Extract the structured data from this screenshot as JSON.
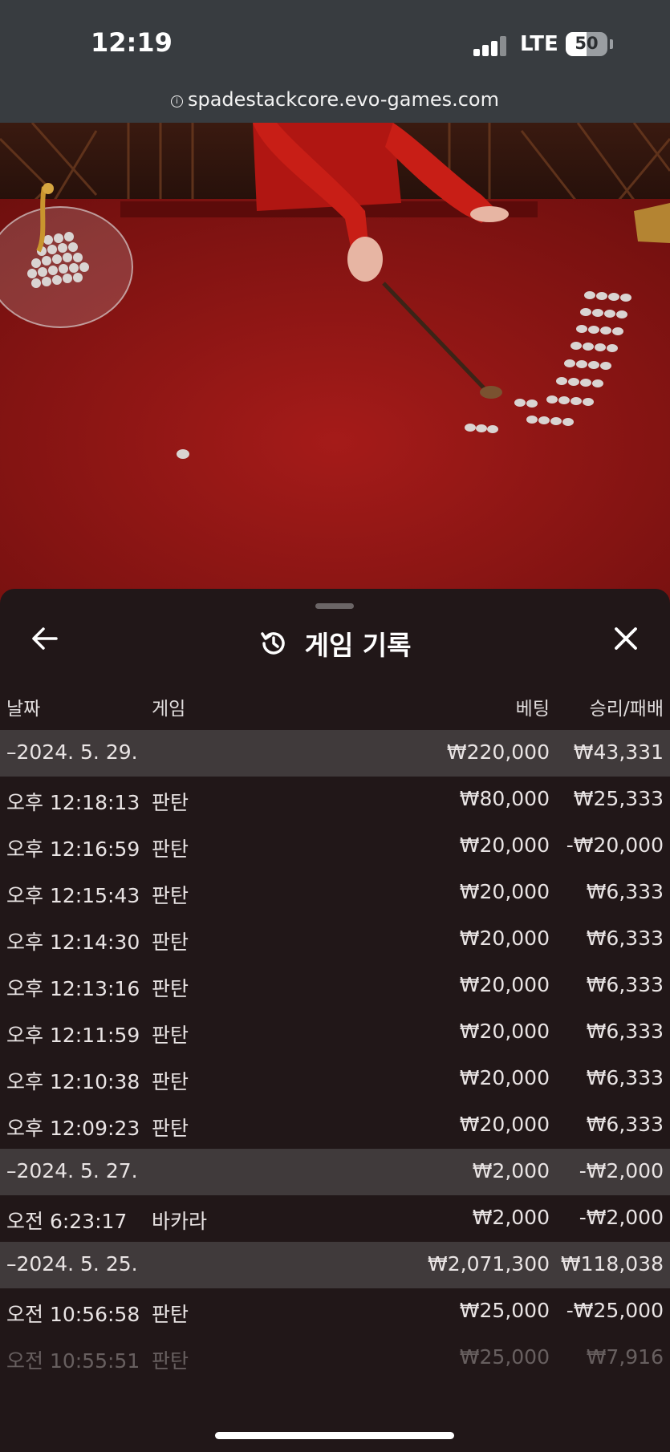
{
  "status_bar": {
    "time": "12:19",
    "network": "LTE",
    "battery": "50",
    "battery_level": 0.5
  },
  "browser": {
    "url": "spadestackcore.evo-games.com"
  },
  "sheet": {
    "title": "게임 기록",
    "back_icon": "arrow-left-icon",
    "close_icon": "close-icon",
    "history_icon": "history-icon"
  },
  "columns": {
    "date": "날짜",
    "game": "게임",
    "bet": "베팅",
    "result": "승리/패배"
  },
  "rows": [
    {
      "type": "date",
      "time": "–2024. 5. 29.",
      "game": "",
      "bet": "₩220,000",
      "result": "₩43,331"
    },
    {
      "type": "entry",
      "time": "오후 12:18:13",
      "game": "판탄",
      "bet": "₩80,000",
      "result": "₩25,333"
    },
    {
      "type": "entry",
      "time": "오후 12:16:59",
      "game": "판탄",
      "bet": "₩20,000",
      "result": "-₩20,000"
    },
    {
      "type": "entry",
      "time": "오후 12:15:43",
      "game": "판탄",
      "bet": "₩20,000",
      "result": "₩6,333"
    },
    {
      "type": "entry",
      "time": "오후 12:14:30",
      "game": "판탄",
      "bet": "₩20,000",
      "result": "₩6,333"
    },
    {
      "type": "entry",
      "time": "오후 12:13:16",
      "game": "판탄",
      "bet": "₩20,000",
      "result": "₩6,333"
    },
    {
      "type": "entry",
      "time": "오후 12:11:59",
      "game": "판탄",
      "bet": "₩20,000",
      "result": "₩6,333"
    },
    {
      "type": "entry",
      "time": "오후 12:10:38",
      "game": "판탄",
      "bet": "₩20,000",
      "result": "₩6,333"
    },
    {
      "type": "entry",
      "time": "오후 12:09:23",
      "game": "판탄",
      "bet": "₩20,000",
      "result": "₩6,333"
    },
    {
      "type": "date",
      "time": "–2024. 5. 27.",
      "game": "",
      "bet": "₩2,000",
      "result": "-₩2,000"
    },
    {
      "type": "entry",
      "time": "오전 6:23:17",
      "game": "바카라",
      "bet": "₩2,000",
      "result": "-₩2,000"
    },
    {
      "type": "date",
      "time": "–2024. 5. 25.",
      "game": "",
      "bet": "₩2,071,300",
      "result": "₩118,038"
    },
    {
      "type": "entry",
      "time": "오전 10:56:58",
      "game": "판탄",
      "bet": "₩25,000",
      "result": "-₩25,000"
    },
    {
      "type": "entry-faded",
      "time": "오전 10:55:51",
      "game": "판탄",
      "bet": "₩25,000",
      "result": "₩7,916"
    }
  ]
}
